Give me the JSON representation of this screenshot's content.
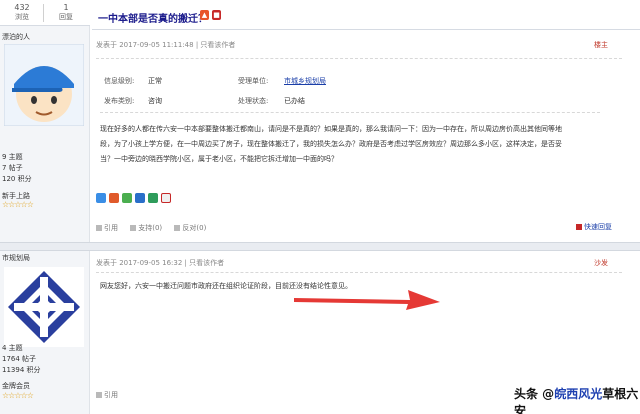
{
  "stats": {
    "views": "432",
    "views_label": "浏览",
    "replies": "1",
    "replies_label": "回复"
  },
  "thread": {
    "title": "一中本部是否真的搬迁？"
  },
  "post1": {
    "user": {
      "name": "漂泊的人",
      "topics": "9 主题",
      "posts": "7 帖子",
      "points": "120 积分",
      "rank": "新手上路",
      "stars": "☆☆☆☆☆"
    },
    "meta": {
      "posted": "发表于 2017-09-05 11:11:48",
      "only_author": "只看该作者"
    },
    "floor": "楼主",
    "info": {
      "info_type_label": "信息级别:",
      "info_type": "正常",
      "unit_label": "受理单位:",
      "unit": "市城乡规划局",
      "category_label": "发布类别:",
      "category": "咨询",
      "status_label": "处理状态:",
      "status": "已办结"
    },
    "body": "现在好多的人都在传六安一中本部要整体搬迁都南山，请问是不是真的？如果是真的，那么我请问一下：因为一中存在，所以周边房价高出其他同等地段，为了小孩上学方便，在一中周边买了房子，现在整体搬迁了，我的损失怎么办？政府是否考虑过学区房效应？周边那么多小区，这样决定，是否妥当？一中旁边的晓西学院小区，属于老小区，不能把它拆迁增加一中面的吗？",
    "actions": {
      "quote": "引用",
      "support": "支持(0)",
      "oppose": "反对(0)"
    },
    "quick_reply": "快速回复"
  },
  "post2": {
    "user": {
      "name": "市规划局",
      "topics": "4 主题",
      "posts": "1764 帖子",
      "points": "11394 积分",
      "rank": "金牌会员",
      "stars": "☆☆☆☆☆"
    },
    "meta": {
      "posted": "发表于 2017-09-05 16:32",
      "only_author": "只看该作者"
    },
    "floor": "沙发",
    "body": "网友您好，六安一中搬迁问题市政府还在组织论证阶段，目前还没有结论性意见。",
    "actions": {
      "quote": "引用"
    }
  },
  "watermark": {
    "prefix": "头条 @",
    "name": "皖西风光",
    "suffix": "草根六安"
  },
  "colors": {
    "title": "#1b1b8c",
    "link": "#1a3ea8",
    "floor": "#c0392b",
    "arrow": "#e53935"
  }
}
